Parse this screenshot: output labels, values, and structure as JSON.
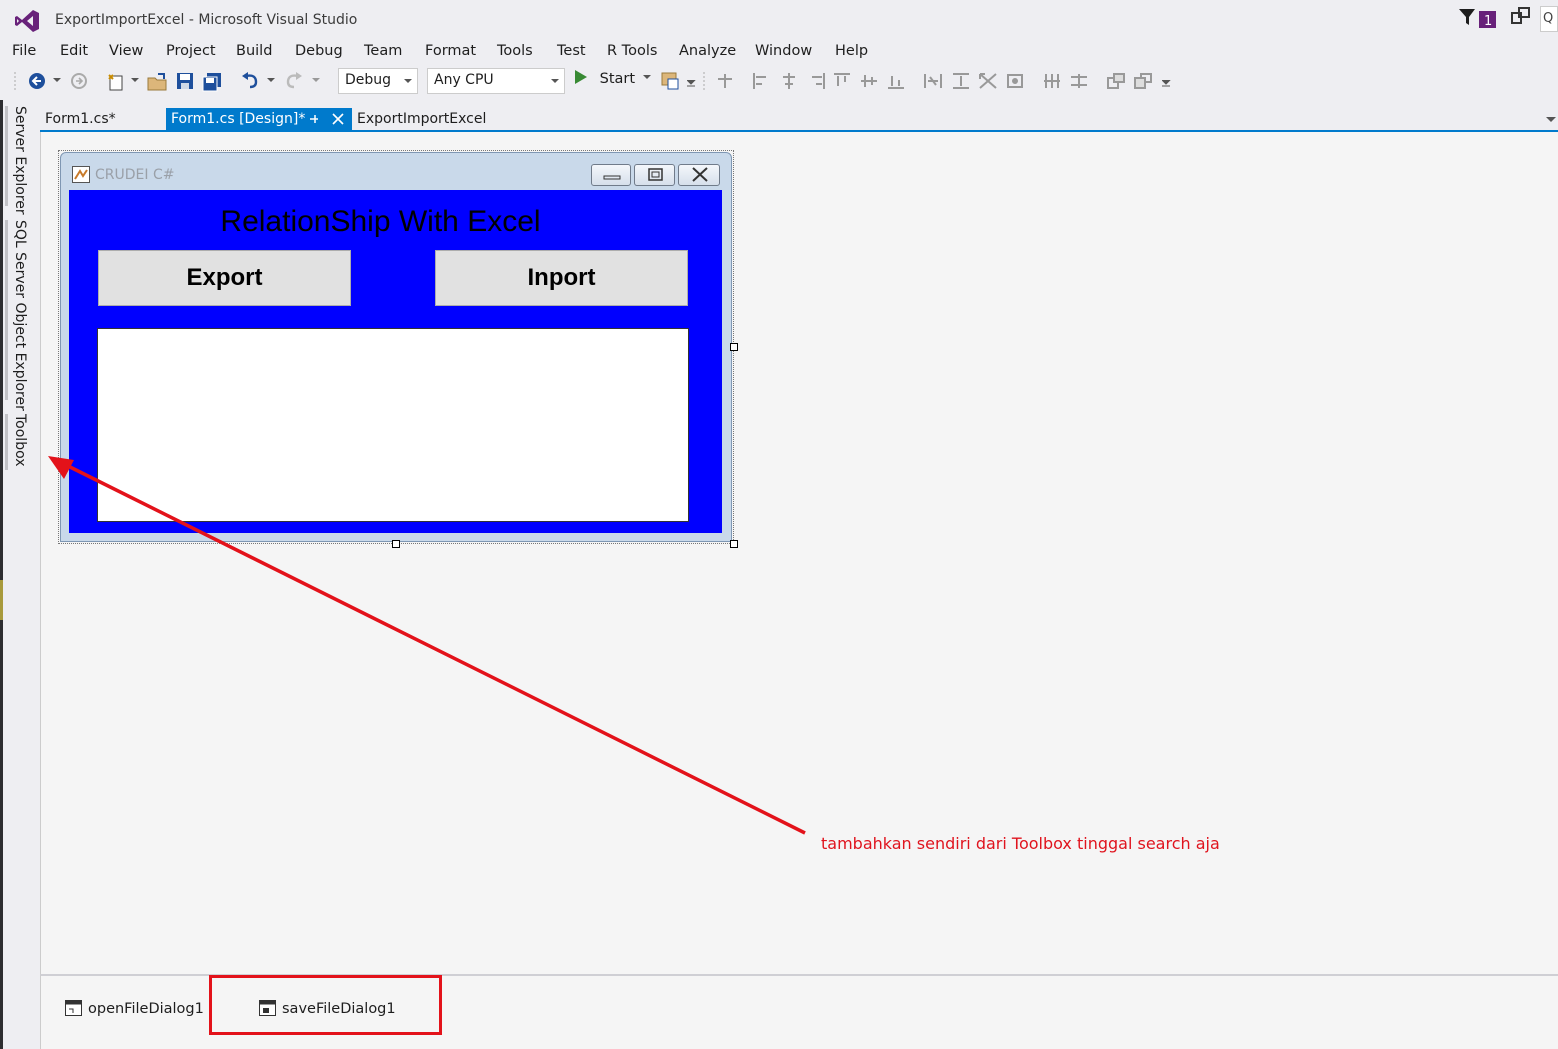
{
  "window": {
    "title": "ExportImportExcel - Microsoft Visual Studio",
    "notification_count": "1",
    "search_stub": "Q"
  },
  "menu": [
    "File",
    "Edit",
    "View",
    "Project",
    "Build",
    "Debug",
    "Team",
    "Format",
    "Tools",
    "Test",
    "R Tools",
    "Analyze",
    "Window",
    "Help"
  ],
  "toolbar": {
    "config": "Debug",
    "platform": "Any CPU",
    "start": "Start"
  },
  "tabs": [
    {
      "label": "Form1.cs*",
      "active": false
    },
    {
      "label": "Form1.cs [Design]*",
      "active": true
    },
    {
      "label": "ExportImportExcel",
      "active": false
    }
  ],
  "side_tabs": [
    "Server Explorer",
    "SQL Server Object Explorer",
    "Toolbox"
  ],
  "form": {
    "caption": "CRUDEI C#",
    "heading": "RelationShip With Excel",
    "export_button": "Export",
    "import_button": "Inport",
    "back_color": "#0000ff"
  },
  "annotation": {
    "text": "tambahkan sendiri dari Toolbox tinggal search aja",
    "color": "#e0141e"
  },
  "component_tray": [
    "openFileDialog1",
    "saveFileDialog1"
  ],
  "colors": {
    "accent": "#007acc",
    "vs_purple": "#68217a"
  }
}
